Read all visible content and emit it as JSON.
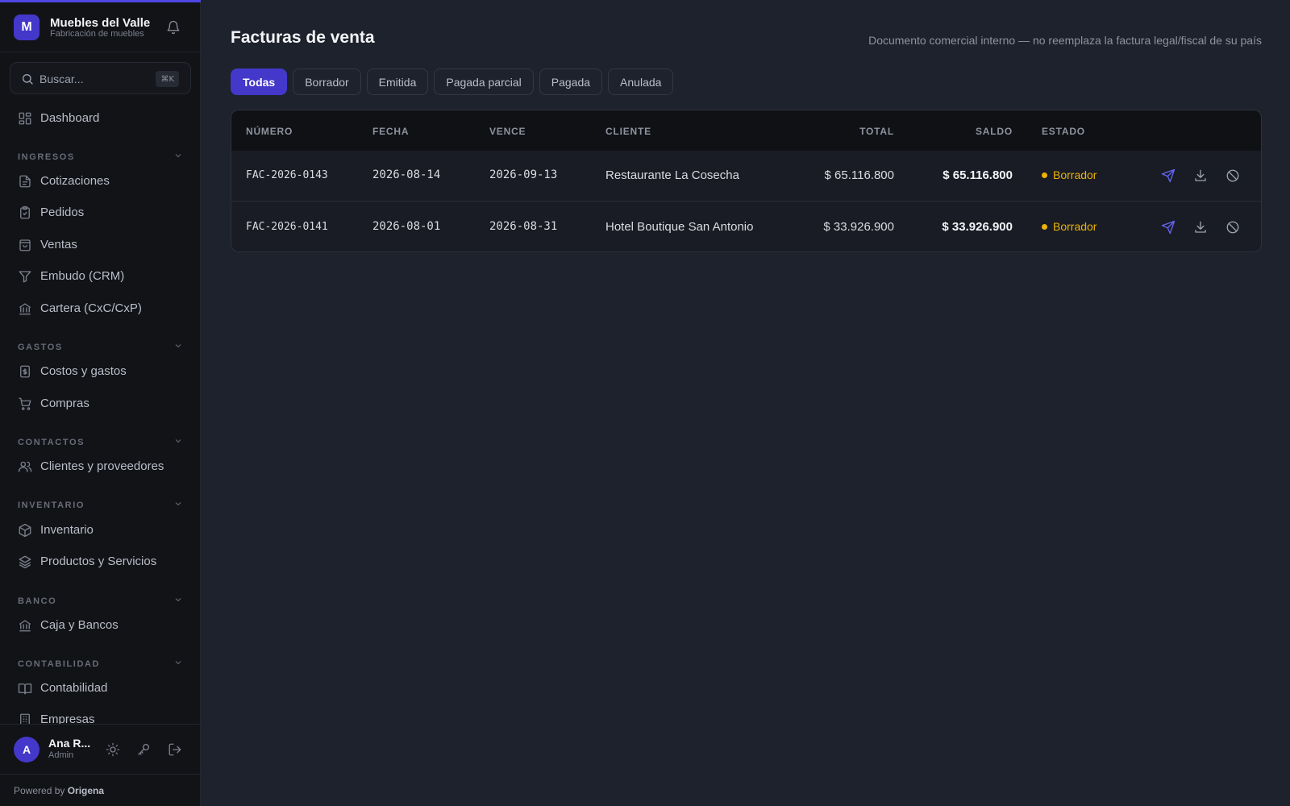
{
  "brand": {
    "logo_letter": "M",
    "name": "Muebles del Valle",
    "subtitle": "Fabricación de muebles"
  },
  "search": {
    "placeholder": "Buscar...",
    "shortcut": "⌘K"
  },
  "nav": {
    "dashboard": "Dashboard",
    "sections": {
      "ingresos": "INGRESOS",
      "gastos": "GASTOS",
      "contactos": "CONTACTOS",
      "inventario": "INVENTARIO",
      "banco": "BANCO",
      "contabilidad": "CONTABILIDAD"
    },
    "items": {
      "cotizaciones": "Cotizaciones",
      "pedidos": "Pedidos",
      "ventas": "Ventas",
      "embudo": "Embudo (CRM)",
      "cartera": "Cartera (CxC/CxP)",
      "costos": "Costos y gastos",
      "compras": "Compras",
      "clientes": "Clientes y proveedores",
      "inventario": "Inventario",
      "productos": "Productos y Servicios",
      "caja": "Caja y Bancos",
      "contabilidad": "Contabilidad",
      "empresas": "Empresas"
    }
  },
  "user": {
    "initial": "A",
    "name": "Ana R...",
    "role": "Admin"
  },
  "footer": {
    "powered_prefix": "Powered by ",
    "powered_brand": "Origena"
  },
  "page": {
    "title": "Facturas de venta",
    "note": "Documento comercial interno — no reemplaza la factura legal/fiscal de su país"
  },
  "tabs": [
    "Todas",
    "Borrador",
    "Emitida",
    "Pagada parcial",
    "Pagada",
    "Anulada"
  ],
  "table": {
    "headers": {
      "numero": "NÚMERO",
      "fecha": "FECHA",
      "vence": "VENCE",
      "cliente": "CLIENTE",
      "total": "TOTAL",
      "saldo": "SALDO",
      "estado": "ESTADO"
    },
    "rows": [
      {
        "numero": "FAC-2026-0143",
        "fecha": "2026-08-14",
        "vence": "2026-09-13",
        "cliente": "Restaurante La Cosecha",
        "total": "$ 65.116.800",
        "saldo": "$ 65.116.800",
        "estado": "Borrador"
      },
      {
        "numero": "FAC-2026-0141",
        "fecha": "2026-08-01",
        "vence": "2026-08-31",
        "cliente": "Hotel Boutique San Antonio",
        "total": "$ 33.926.900",
        "saldo": "$ 33.926.900",
        "estado": "Borrador"
      }
    ]
  },
  "colors": {
    "accent": "#4338ca",
    "status_draft": "#eab308",
    "send_icon": "#6366f1"
  },
  "icons": {
    "row_actions": [
      "send-icon",
      "download-icon",
      "void-icon"
    ]
  }
}
